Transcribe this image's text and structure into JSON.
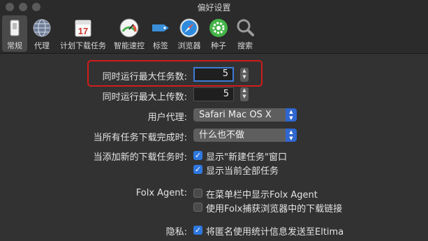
{
  "window": {
    "title": "偏好设置"
  },
  "toolbar": {
    "items": [
      {
        "label": "常规",
        "icon": "general-switch-icon",
        "active": true
      },
      {
        "label": "代理",
        "icon": "globe-icon"
      },
      {
        "label": "计划下载任务",
        "icon": "calendar-icon",
        "icon_text": "17"
      },
      {
        "label": "智能速控",
        "icon": "speedometer-icon"
      },
      {
        "label": "标签",
        "icon": "tag-icon"
      },
      {
        "label": "浏览器",
        "icon": "compass-icon"
      },
      {
        "label": "种子",
        "icon": "gear-icon"
      },
      {
        "label": "搜索",
        "icon": "search-icon"
      }
    ]
  },
  "settings": {
    "max_tasks": {
      "label": "同时运行最大任务数:",
      "value": "5"
    },
    "max_uploads": {
      "label": "同时运行最大上传数:",
      "value": "5"
    },
    "user_agent": {
      "label": "用户代理:",
      "value": "Safari Mac OS X"
    },
    "on_complete": {
      "label": "当所有任务下载完成时:",
      "value": "什么也不做"
    },
    "on_add": {
      "label": "当添加新的下载任务时:",
      "options": [
        {
          "text": "显示\"新建任务\"窗口",
          "checked": true
        },
        {
          "text": "显示当前全部任务",
          "checked": true
        }
      ]
    },
    "folx_agent": {
      "label": "Folx Agent:",
      "options": [
        {
          "text": "在菜单栏中显示Folx Agent",
          "checked": false
        },
        {
          "text": "使用Folx捕获浏览器中的下载链接",
          "checked": false
        }
      ]
    },
    "privacy": {
      "label": "隐私:",
      "options": [
        {
          "text": "将匿名使用统计信息发送至Eltima",
          "checked": true
        }
      ]
    }
  },
  "colors": {
    "accent": "#2f78e0",
    "highlight": "#d21c1c",
    "background": "#323232"
  }
}
